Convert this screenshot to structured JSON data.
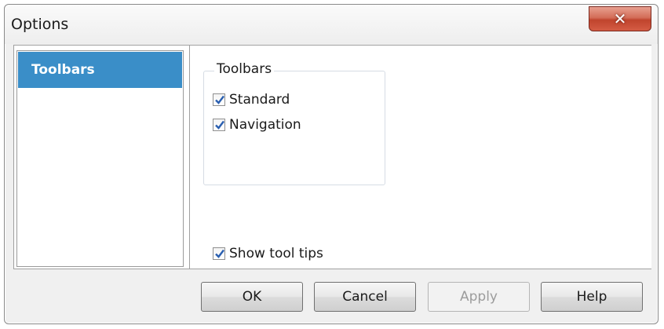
{
  "window": {
    "title": "Options",
    "close_label": "✕"
  },
  "nav": {
    "items": [
      {
        "label": "Toolbars",
        "selected": true
      }
    ]
  },
  "panel": {
    "group_title": "Toolbars",
    "checkboxes": [
      {
        "label": "Standard",
        "checked": true
      },
      {
        "label": "Navigation",
        "checked": true
      }
    ],
    "tooltips": {
      "label": "Show tool tips",
      "checked": true
    }
  },
  "buttons": {
    "ok": "OK",
    "cancel": "Cancel",
    "apply": "Apply",
    "help": "Help"
  },
  "colors": {
    "selection": "#3a8ec8",
    "check": "#2a5fb0",
    "close": "#c7503a"
  }
}
